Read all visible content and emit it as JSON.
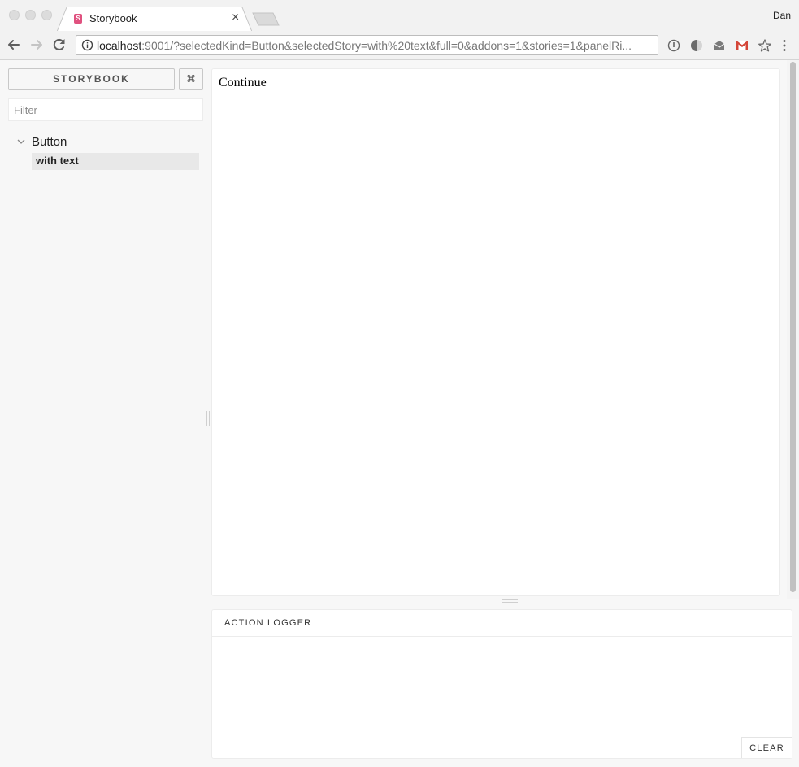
{
  "window": {
    "tab_title": "Storybook",
    "favicon_letter": "S",
    "tab_close": "×",
    "profile_name": "Dan"
  },
  "omnibox": {
    "host": "localhost",
    "rest": ":9001/?selectedKind=Button&selectedStory=with%20text&full=0&addons=1&stories=1&panelRi..."
  },
  "storybook": {
    "brand_label": "STORYBOOK",
    "shortcut_label": "⌘",
    "filter_placeholder": "Filter",
    "kinds": [
      {
        "label": "Button",
        "stories": [
          {
            "label": "with text",
            "selected": true
          }
        ]
      }
    ]
  },
  "preview": {
    "button_label": "Continue"
  },
  "addon_panel": {
    "tab_label": "ACTION LOGGER",
    "clear_label": "CLEAR"
  }
}
